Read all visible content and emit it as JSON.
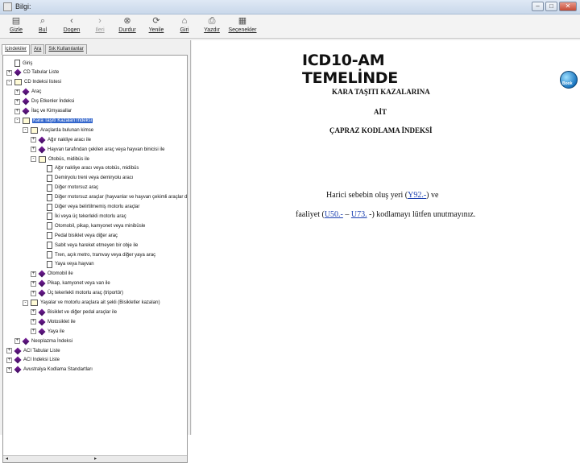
{
  "window": {
    "title": "Bilgi:",
    "controls": {
      "minimize": "–",
      "maximize": "□",
      "close": "✕"
    }
  },
  "toolbar": {
    "items": [
      {
        "label": "Gizle",
        "icon": "hide-icon"
      },
      {
        "label": "Bul",
        "icon": "find-icon"
      },
      {
        "label": "Dogen",
        "icon": "back-icon"
      },
      {
        "label": "Ileri",
        "icon": "forward-icon"
      },
      {
        "label": "Durdur",
        "icon": "stop-icon"
      },
      {
        "label": "Yenile",
        "icon": "refresh-icon"
      },
      {
        "label": "Giri",
        "icon": "home-icon"
      },
      {
        "label": "Yazdır",
        "icon": "print-icon"
      },
      {
        "label": "Seçenekler",
        "icon": "options-icon"
      }
    ]
  },
  "sidebar": {
    "tabs": [
      "İçindekiler",
      "Ara",
      "Sık Kullanılanlar"
    ],
    "tree": [
      {
        "level": 0,
        "exp": "",
        "icon": "page",
        "text": "Giriş"
      },
      {
        "level": 0,
        "exp": "+",
        "icon": "book",
        "text": "CD Tabular Liste"
      },
      {
        "level": 0,
        "exp": "-",
        "icon": "open",
        "text": "CD Indeksi listesi"
      },
      {
        "level": 1,
        "exp": "+",
        "icon": "book",
        "text": "Araç"
      },
      {
        "level": 1,
        "exp": "+",
        "icon": "book",
        "text": "Dış Etkenler İndeksi"
      },
      {
        "level": 1,
        "exp": "+",
        "icon": "book",
        "text": "İlaç ve Kimyasallar"
      },
      {
        "level": 1,
        "exp": "-",
        "icon": "open",
        "text": "Kara Taşıtı Kazaları İndeksi",
        "selected": true
      },
      {
        "level": 2,
        "exp": "-",
        "icon": "open",
        "text": "Araçlarda bulunan kimse"
      },
      {
        "level": 3,
        "exp": "+",
        "icon": "book",
        "text": "Ağır nakliye aracı ile"
      },
      {
        "level": 3,
        "exp": "+",
        "icon": "book",
        "text": "Hayvan tarafından çekilen araç veya hayvan binicisi ile"
      },
      {
        "level": 3,
        "exp": "-",
        "icon": "open",
        "text": "Otobüs, midibüs ile"
      },
      {
        "level": 4,
        "exp": "",
        "icon": "page",
        "text": "Ağır nakliye aracı veya otobüs, midibüs"
      },
      {
        "level": 4,
        "exp": "",
        "icon": "page",
        "text": "Demiryolu treni veya demiryolu aracı"
      },
      {
        "level": 4,
        "exp": "",
        "icon": "page",
        "text": "Diğer motorsuz araç"
      },
      {
        "level": 4,
        "exp": "",
        "icon": "page",
        "text": "Diğer motorsuz araçlar (hayvanlar ve hayvan çekimli araçlar dahil)"
      },
      {
        "level": 4,
        "exp": "",
        "icon": "page",
        "text": "Diğer veya belirtilmemiş motorlu araçlar"
      },
      {
        "level": 4,
        "exp": "",
        "icon": "page",
        "text": "İki veya üç tekerlekli motorlu araç"
      },
      {
        "level": 4,
        "exp": "",
        "icon": "page",
        "text": "Otomobil, pikap, kamyonet veya minibüsle"
      },
      {
        "level": 4,
        "exp": "",
        "icon": "page",
        "text": "Pedal bisiklet veya diğer araç"
      },
      {
        "level": 4,
        "exp": "",
        "icon": "page",
        "text": "Sabit veya hareket etmeyen bir obje ile"
      },
      {
        "level": 4,
        "exp": "",
        "icon": "page",
        "text": "Tren, açık metro, tramvay veya diğer yaya araç"
      },
      {
        "level": 4,
        "exp": "",
        "icon": "page",
        "text": "Yaya veya hayvan"
      },
      {
        "level": 3,
        "exp": "+",
        "icon": "book",
        "text": "Otomobil ile"
      },
      {
        "level": 3,
        "exp": "+",
        "icon": "book",
        "text": "Pikap, kamyonet veya van ile"
      },
      {
        "level": 3,
        "exp": "+",
        "icon": "book",
        "text": "Üç tekerlekli motorlu araç (triportör)"
      },
      {
        "level": 2,
        "exp": "-",
        "icon": "open",
        "text": "Yayalar ve motorlu araçlara ait şekli (Bisikletler kazaları)"
      },
      {
        "level": 3,
        "exp": "+",
        "icon": "book",
        "text": "Bisiklet ve diğer pedal araçlar ile"
      },
      {
        "level": 3,
        "exp": "+",
        "icon": "book",
        "text": "Motosiklet ile"
      },
      {
        "level": 3,
        "exp": "+",
        "icon": "book",
        "text": "Yaya ile"
      },
      {
        "level": 1,
        "exp": "+",
        "icon": "book",
        "text": "Neoplazma İndeksi"
      },
      {
        "level": 0,
        "exp": "+",
        "icon": "book",
        "text": "ACI Tabular Liste"
      },
      {
        "level": 0,
        "exp": "+",
        "icon": "book",
        "text": "ACI Indeksi Liste"
      },
      {
        "level": 0,
        "exp": "+",
        "icon": "book",
        "text": "Avustralya Kodlama Standartları"
      }
    ],
    "scroll_left": "◂",
    "scroll_right": "▸"
  },
  "content": {
    "title": "ICD10-AM TEMELİNDE",
    "heading1": "KARA TAŞITI KAZALARINA",
    "heading2": "AİT",
    "heading3": "ÇAPRAZ KODLAMA İNDEKSİ",
    "para1_prefix": "Harici sebebin oluş yeri (",
    "para1_link": "Y92.-",
    "para1_suffix": ") ve",
    "para2_prefix": "faaliyet (",
    "para2_link1": "U50.-",
    "para2_mid": " – ",
    "para2_link2": "U73.",
    "para2_suffix": " -) kodlamayı lütfen unutmayınız.",
    "badge_label": "Book"
  }
}
